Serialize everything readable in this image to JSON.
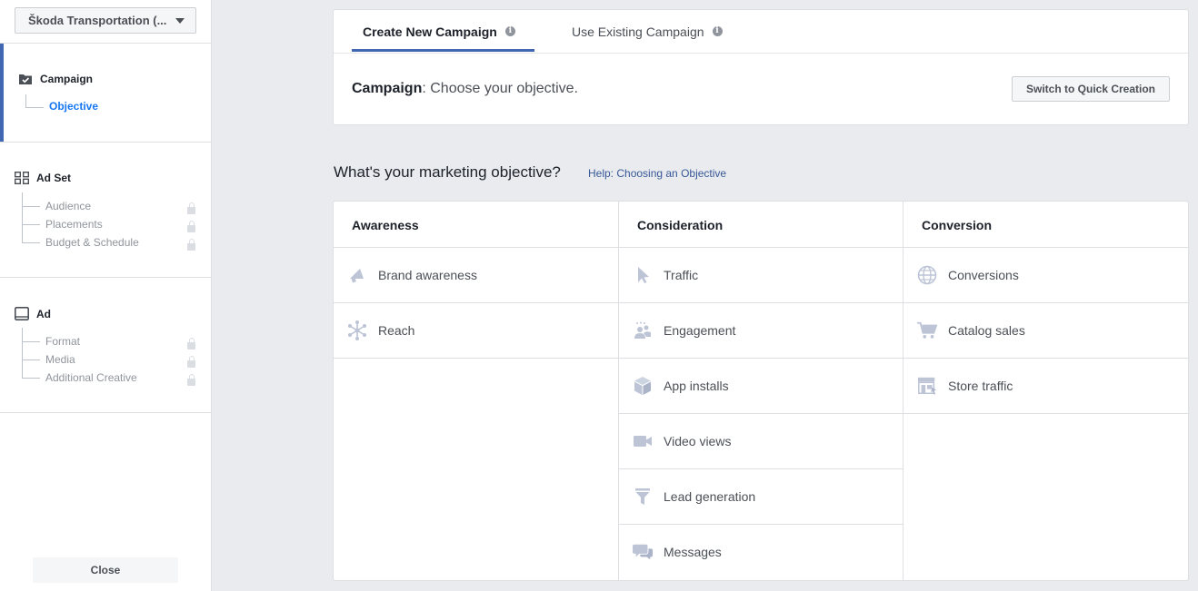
{
  "sidebar": {
    "account_label": "Škoda Transportation (...",
    "campaign": {
      "title": "Campaign",
      "sub": "Objective"
    },
    "adset": {
      "title": "Ad Set",
      "items": [
        "Audience",
        "Placements",
        "Budget & Schedule"
      ]
    },
    "ad": {
      "title": "Ad",
      "items": [
        "Format",
        "Media",
        "Additional Creative"
      ]
    },
    "close_label": "Close"
  },
  "tabs": {
    "create_label": "Create New Campaign",
    "existing_label": "Use Existing Campaign"
  },
  "campaign_header": {
    "bold": "Campaign",
    "text": ": Choose your objective.",
    "quick_button": "Switch to Quick Creation"
  },
  "objective_section": {
    "heading": "What's your marketing objective?",
    "help_link": "Help: Choosing an Objective"
  },
  "columns": {
    "awareness": {
      "title": "Awareness",
      "items": [
        "Brand awareness",
        "Reach"
      ]
    },
    "consideration": {
      "title": "Consideration",
      "items": [
        "Traffic",
        "Engagement",
        "App installs",
        "Video views",
        "Lead generation",
        "Messages"
      ]
    },
    "conversion": {
      "title": "Conversion",
      "items": [
        "Conversions",
        "Catalog sales",
        "Store traffic"
      ]
    }
  },
  "colors": {
    "accent": "#4267b2",
    "link": "#385898",
    "active_blue": "#1877f2",
    "icon": "#bcc4d6"
  },
  "icons": {
    "awareness": [
      "megaphone-icon",
      "reach-icon"
    ],
    "consideration": [
      "cursor-icon",
      "people-icon",
      "box-icon",
      "video-camera-icon",
      "funnel-icon",
      "chat-icon"
    ],
    "conversion": [
      "globe-icon",
      "cart-icon",
      "store-icon"
    ]
  }
}
